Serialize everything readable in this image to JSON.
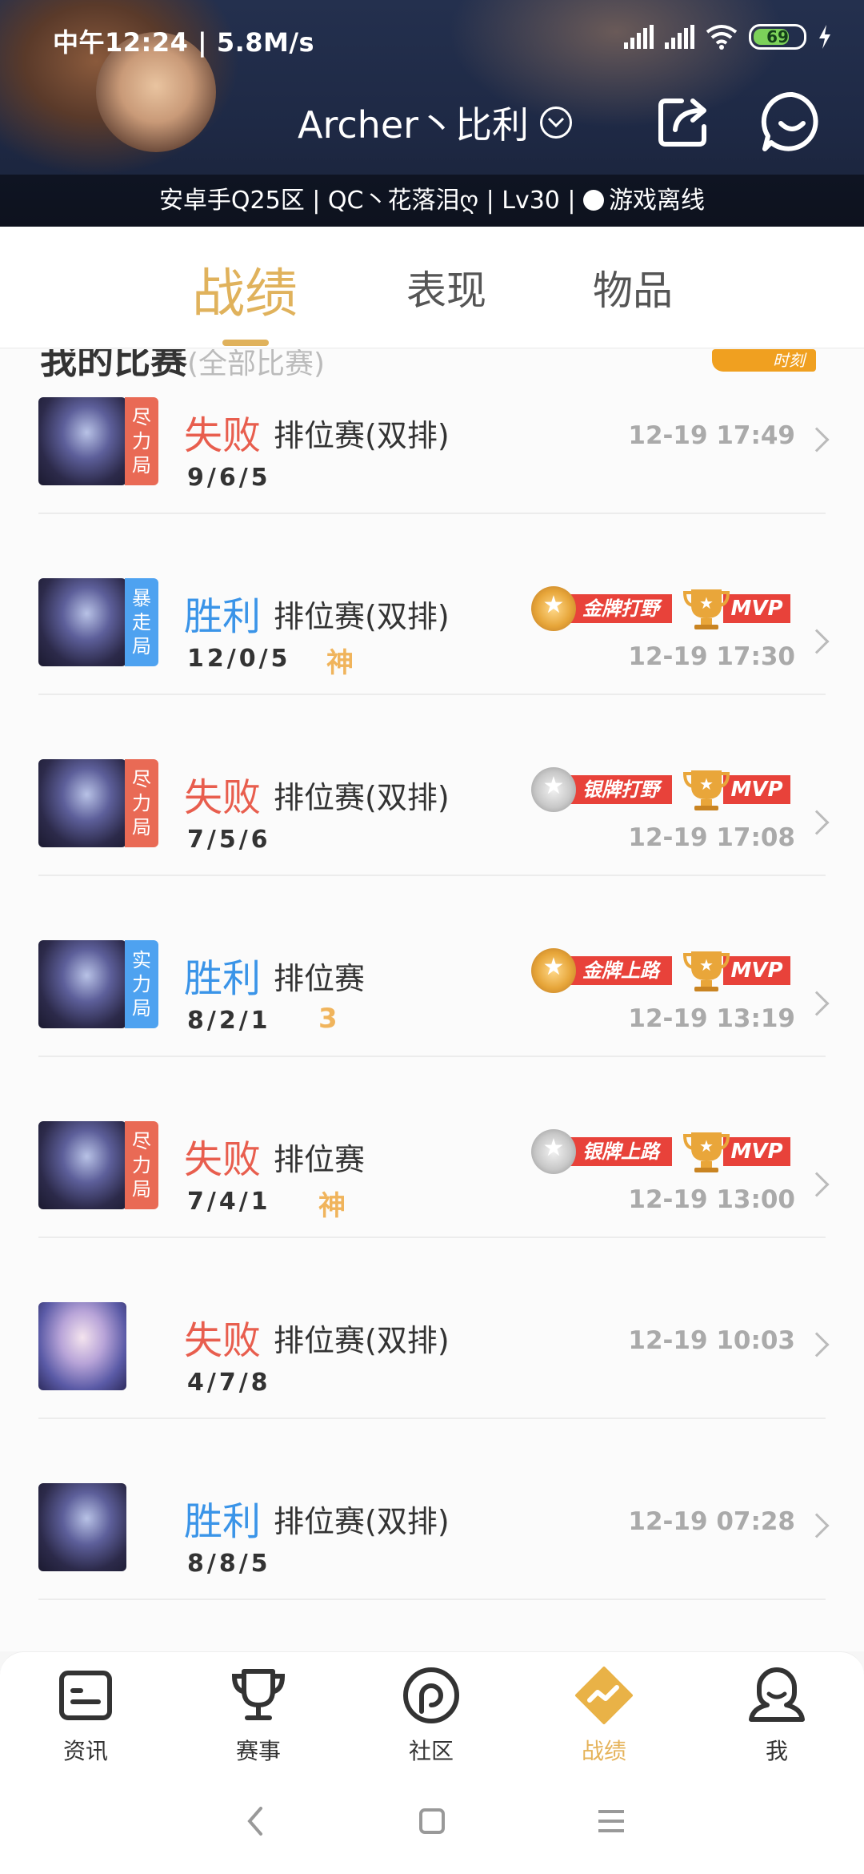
{
  "status": {
    "left_text": "中午12:24 | 5.8M/s",
    "battery": "69"
  },
  "profile": {
    "name": "Archer丶比利",
    "subtitle": "安卓手Q25区 | QC丶花落泪ღ | Lv30 | ",
    "online_status": "游戏离线"
  },
  "tabs": [
    {
      "label": "战绩",
      "active": true
    },
    {
      "label": "表现",
      "active": false
    },
    {
      "label": "物品",
      "active": false
    }
  ],
  "section": {
    "title": "我的比赛",
    "filter": "(全部比赛)",
    "moments_label": "时刻"
  },
  "matches": [
    {
      "tag": "尽力局",
      "tag_color": "red",
      "result": "失败",
      "outcome": "lose",
      "mode": "排位赛(双排)",
      "kda": "9/6/5",
      "extra": "",
      "time": "12-19 17:49",
      "badges": [],
      "avatar": "dark"
    },
    {
      "tag": "暴走局",
      "tag_color": "blue",
      "result": "胜利",
      "outcome": "win",
      "mode": "排位赛(双排)",
      "kda": "12/0/5",
      "extra": "神",
      "time": "12-19 17:30",
      "badges": [
        {
          "type": "medal",
          "tier": "gold",
          "text": "金牌打野"
        },
        {
          "type": "mvp",
          "text": "MVP"
        }
      ],
      "avatar": "dark"
    },
    {
      "tag": "尽力局",
      "tag_color": "red",
      "result": "失败",
      "outcome": "lose",
      "mode": "排位赛(双排)",
      "kda": "7/5/6",
      "extra": "",
      "time": "12-19 17:08",
      "badges": [
        {
          "type": "medal",
          "tier": "silver",
          "text": "银牌打野"
        },
        {
          "type": "mvp",
          "text": "MVP"
        }
      ],
      "avatar": "dark"
    },
    {
      "tag": "实力局",
      "tag_color": "blue",
      "result": "胜利",
      "outcome": "win",
      "mode": "排位赛",
      "kda": "8/2/1",
      "extra": "3",
      "time": "12-19 13:19",
      "badges": [
        {
          "type": "medal",
          "tier": "gold",
          "text": "金牌上路"
        },
        {
          "type": "mvp",
          "text": "MVP"
        }
      ],
      "avatar": "dark"
    },
    {
      "tag": "尽力局",
      "tag_color": "red",
      "result": "失败",
      "outcome": "lose",
      "mode": "排位赛",
      "kda": "7/4/1",
      "extra": "神",
      "time": "12-19 13:00",
      "badges": [
        {
          "type": "medal",
          "tier": "silver",
          "text": "银牌上路"
        },
        {
          "type": "mvp",
          "text": "MVP"
        }
      ],
      "avatar": "dark"
    },
    {
      "tag": "",
      "tag_color": "",
      "result": "失败",
      "outcome": "lose",
      "mode": "排位赛(双排)",
      "kda": "4/7/8",
      "extra": "",
      "time": "12-19 10:03",
      "badges": [],
      "avatar": "light"
    },
    {
      "tag": "",
      "tag_color": "",
      "result": "胜利",
      "outcome": "win",
      "mode": "排位赛(双排)",
      "kda": "8/8/5",
      "extra": "",
      "time": "12-19 07:28",
      "badges": [],
      "avatar": "dark"
    }
  ],
  "bottom_nav": [
    {
      "label": "资讯",
      "icon": "news-icon",
      "active": false
    },
    {
      "label": "赛事",
      "icon": "trophy-icon",
      "active": false
    },
    {
      "label": "社区",
      "icon": "community-icon",
      "active": false
    },
    {
      "label": "战绩",
      "icon": "record-icon",
      "active": true
    },
    {
      "label": "我",
      "icon": "profile-icon",
      "active": false
    }
  ],
  "colors": {
    "accent": "#e0b25c",
    "lose": "#e85e4e",
    "win": "#3a94e8"
  }
}
